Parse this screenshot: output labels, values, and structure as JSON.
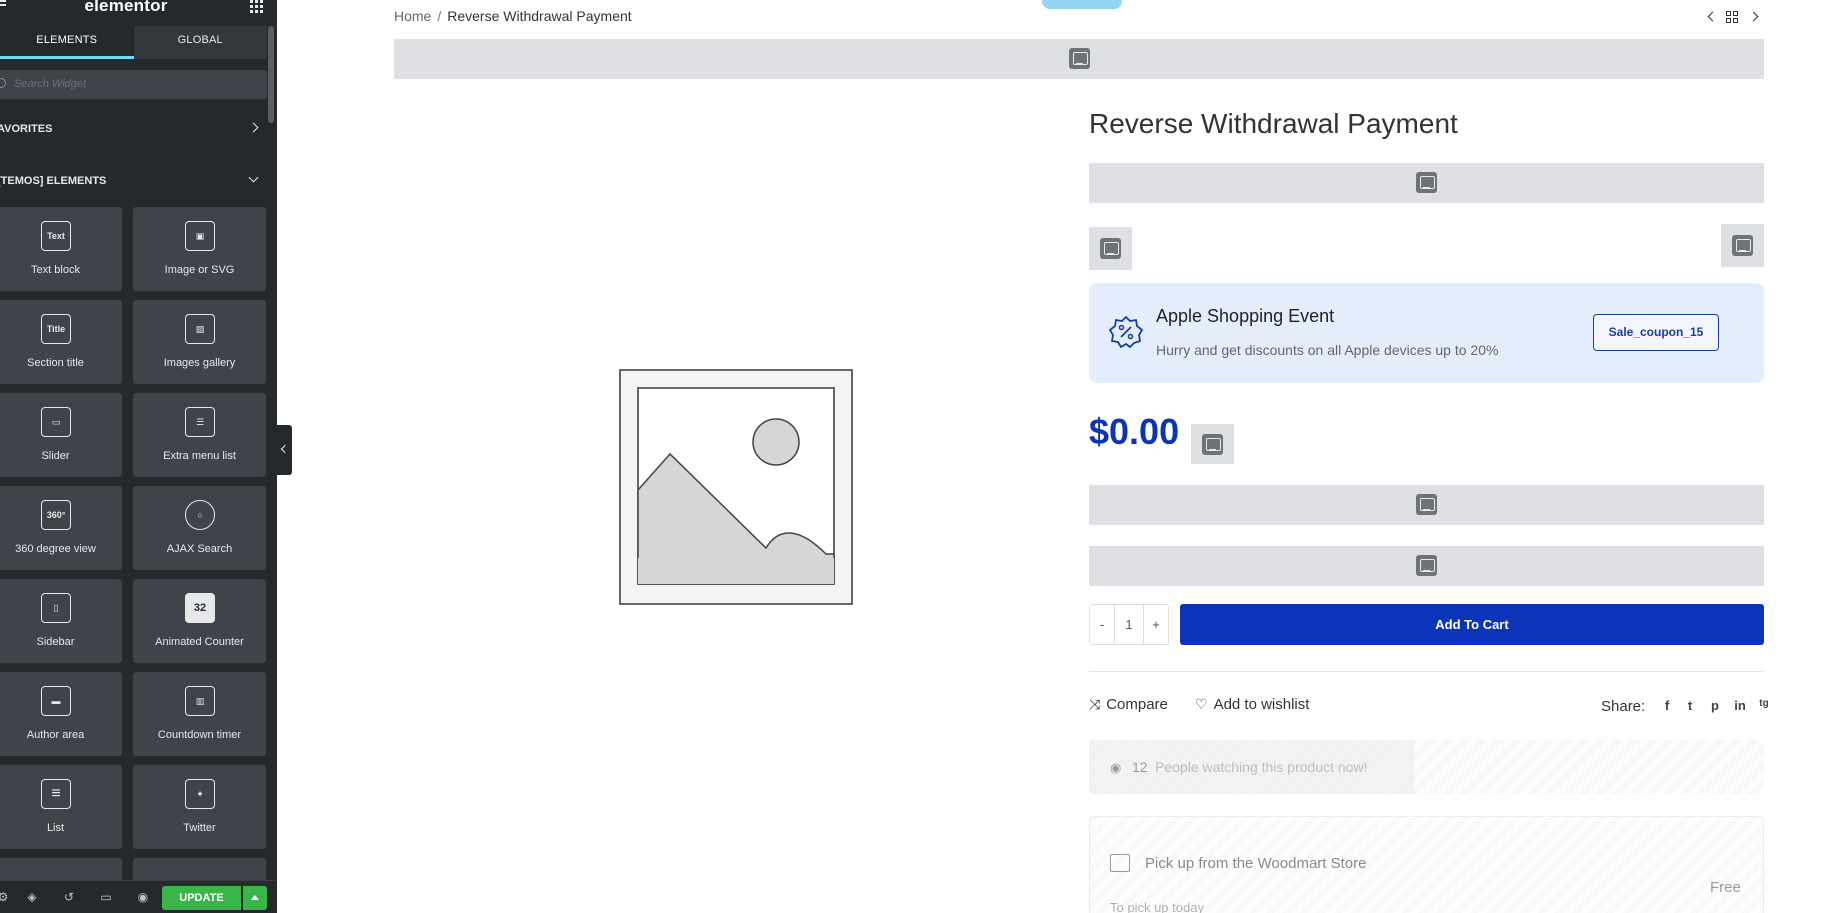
{
  "panel": {
    "logo": "elementor",
    "tabs": [
      {
        "label": "ELEMENTS",
        "active": true
      },
      {
        "label": "GLOBAL",
        "active": false
      }
    ],
    "search_placeholder": "Search Widget",
    "categories": [
      {
        "label": "AVORITES",
        "state": "collapsed"
      },
      {
        "label": "[TEMOS] ELEMENTS",
        "state": "expanded"
      }
    ],
    "widgets": [
      {
        "label": "Text block",
        "icon": "text-block-icon",
        "glyph": "Text"
      },
      {
        "label": "Image or SVG",
        "icon": "image-svg-icon",
        "glyph": "▣"
      },
      {
        "label": "Section title",
        "icon": "section-title-icon",
        "glyph": "Title"
      },
      {
        "label": "Images gallery",
        "icon": "images-gallery-icon",
        "glyph": "▨"
      },
      {
        "label": "Slider",
        "icon": "slider-icon",
        "glyph": "▭"
      },
      {
        "label": "Extra menu list",
        "icon": "extra-menu-list-icon",
        "glyph": "☰"
      },
      {
        "label": "360 degree view",
        "icon": "360-view-icon",
        "glyph": "360°"
      },
      {
        "label": "AJAX Search",
        "icon": "ajax-search-icon",
        "glyph": "○"
      },
      {
        "label": "Sidebar",
        "icon": "sidebar-icon",
        "glyph": "▯"
      },
      {
        "label": "Animated Counter",
        "icon": "animated-counter-icon",
        "glyph": "32"
      },
      {
        "label": "Author area",
        "icon": "author-area-icon",
        "glyph": "▬"
      },
      {
        "label": "Countdown timer",
        "icon": "countdown-timer-icon",
        "glyph": "▥"
      },
      {
        "label": "List",
        "icon": "list-icon",
        "glyph": "≡"
      },
      {
        "label": "Twitter",
        "icon": "twitter-icon",
        "glyph": "✦"
      }
    ],
    "footer": {
      "update_label": "UPDATE"
    }
  },
  "preview": {
    "breadcrumb": {
      "home": "Home",
      "separator": "/",
      "current": "Reverse Withdrawal Payment"
    },
    "product": {
      "title": "Reverse Withdrawal Payment",
      "price": "$0.00"
    },
    "coupon": {
      "title": "Apple Shopping Event",
      "description": "Hurry and get discounts on all Apple devices up to 20%",
      "code": "Sale_coupon_15"
    },
    "quantity": {
      "minus": "-",
      "value": "1",
      "plus": "+"
    },
    "add_to_cart_label": "Add To Cart",
    "actions": {
      "compare": "Compare",
      "wishlist": "Add to wishlist",
      "share": "Share:",
      "social": [
        "f",
        "t",
        "p",
        "in",
        "tg"
      ]
    },
    "watching": {
      "count": "12",
      "text": "People watching this product now!"
    },
    "pickup": {
      "title": "Pick up from the Woodmart Store",
      "price": "Free",
      "subtitle": "To pick up today"
    }
  },
  "colors": {
    "accent_blue": "#0c34b8",
    "update_green": "#39b54a",
    "panel_dark": "#26292c",
    "placeholder_gray": "#dfe0e4",
    "coupon_bg": "#e4eefb"
  }
}
